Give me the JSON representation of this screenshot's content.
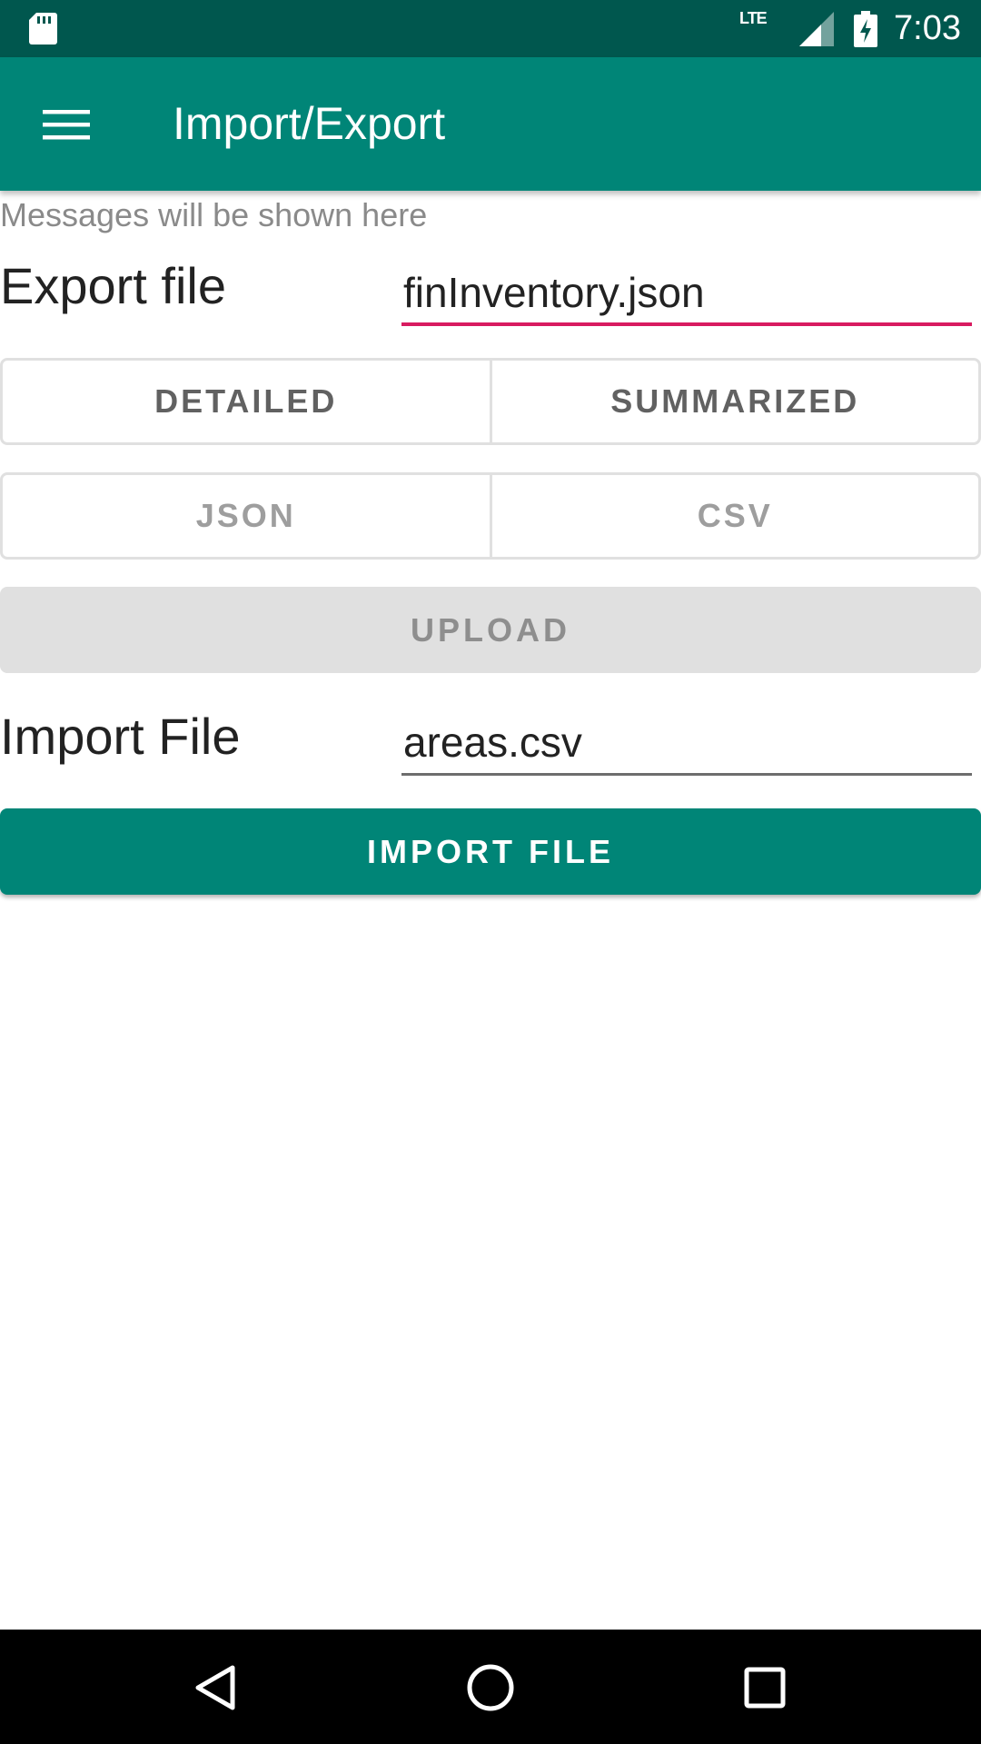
{
  "status_bar": {
    "network": "LTE",
    "time": "7:03"
  },
  "app_bar": {
    "title": "Import/Export",
    "menu_icon": "hamburger-menu-icon"
  },
  "messages": "Messages will be shown here",
  "export": {
    "label": "Export file",
    "value": "finInventory.json"
  },
  "detail_toggle": {
    "options": [
      "DETAILED",
      "SUMMARIZED"
    ]
  },
  "format_toggle": {
    "options": [
      "JSON",
      "CSV"
    ]
  },
  "upload_button": "UPLOAD",
  "import": {
    "label": "Import File",
    "value": "areas.csv"
  },
  "import_button": "IMPORT FILE",
  "colors": {
    "status_bar": "#00574e",
    "primary": "#008577",
    "accent": "#d81b60"
  },
  "nav_bar": {
    "back_icon": "back-icon",
    "home_icon": "home-icon",
    "recents_icon": "recents-icon"
  }
}
